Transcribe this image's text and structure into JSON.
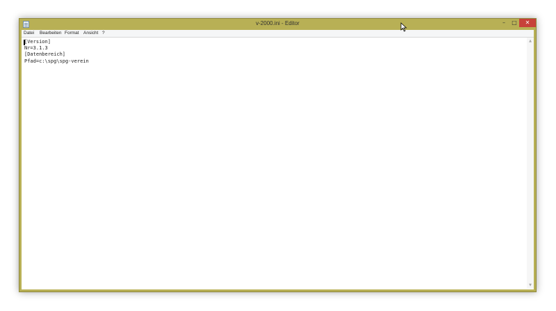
{
  "window": {
    "title": "v-2000.ini - Editor",
    "colors": {
      "frame": "#b8b055",
      "close_button": "#c7413a"
    }
  },
  "titlebar": {
    "app_icon": "notepad-icon",
    "minimize_glyph": "–",
    "maximize_glyph": "□",
    "close_glyph": "✕"
  },
  "menu": {
    "items": [
      "Datei",
      "Bearbeiten",
      "Format",
      "Ansicht",
      "?"
    ]
  },
  "editor": {
    "content": "[Version]\nNr=3.1.3\n[Datenbereich]\nPfad=c:\\spg\\spg-verein"
  },
  "scrollbar": {
    "up_arrow": "▲",
    "down_arrow": "▼"
  }
}
